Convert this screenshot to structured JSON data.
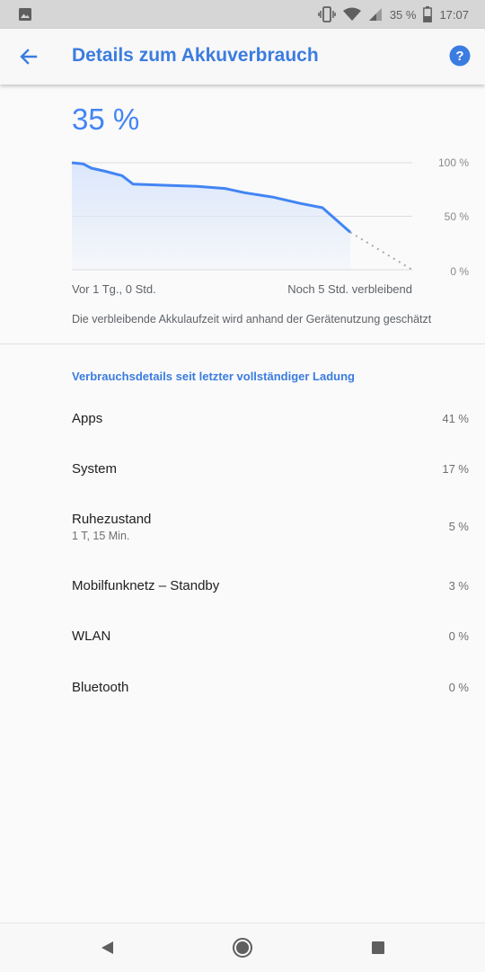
{
  "status_bar": {
    "battery_percent": "35 %",
    "time": "17:07",
    "icons": [
      "image-notification-icon",
      "vibrate-icon",
      "wifi-icon",
      "signal-icon",
      "battery-icon"
    ]
  },
  "app_bar": {
    "title": "Details zum Akkuverbrauch",
    "back_icon": "arrow-back-icon",
    "help_icon": "help-icon",
    "accent": "#3b7ce0"
  },
  "battery_level": "35 %",
  "chart_data": {
    "type": "area",
    "y_tick_labels": [
      "100 %",
      "50 %",
      "0 %"
    ],
    "ylim": [
      0,
      100
    ],
    "x_start_label": "Vor 1 Tg., 0 Std.",
    "x_end_label": "Noch 5 Std. verbleibend",
    "history": [
      [
        0,
        100
      ],
      [
        0.04,
        99
      ],
      [
        0.07,
        95
      ],
      [
        0.12,
        92
      ],
      [
        0.18,
        88
      ],
      [
        0.22,
        80
      ],
      [
        0.33,
        79
      ],
      [
        0.45,
        78
      ],
      [
        0.55,
        76
      ],
      [
        0.62,
        72
      ],
      [
        0.72,
        68
      ],
      [
        0.82,
        62
      ],
      [
        0.9,
        58
      ],
      [
        1.0,
        35
      ]
    ],
    "projection": [
      [
        1.0,
        35
      ],
      [
        1.4,
        0
      ]
    ],
    "line_color": "#4285f4",
    "fill_color": "#dbe7fb",
    "grid": true
  },
  "estimate_note": "Die verbleibende Akkulaufzeit wird anhand der Gerätenutzung geschätzt",
  "usage": {
    "header": "Verbrauchsdetails seit letzter vollständiger Ladung",
    "items": [
      {
        "name": "Apps",
        "sub": "",
        "percent": "41 %"
      },
      {
        "name": "System",
        "sub": "",
        "percent": "17 %"
      },
      {
        "name": "Ruhezustand",
        "sub": "1 T, 15 Min.",
        "percent": "5 %"
      },
      {
        "name": "Mobilfunknetz – Standby",
        "sub": "",
        "percent": "3 %"
      },
      {
        "name": "WLAN",
        "sub": "",
        "percent": "0 %"
      },
      {
        "name": "Bluetooth",
        "sub": "",
        "percent": "0 %"
      }
    ]
  },
  "nav_bar": {
    "icons": [
      "back-triangle-icon",
      "home-circle-icon",
      "recents-square-icon"
    ]
  }
}
